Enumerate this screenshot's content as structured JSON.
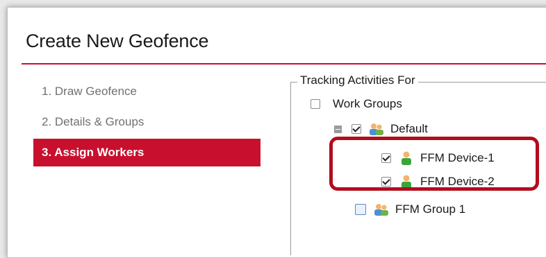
{
  "page": {
    "title": "Create New Geofence"
  },
  "steps": [
    {
      "label": "1.  Draw Geofence",
      "active": false
    },
    {
      "label": "2.  Details & Groups",
      "active": false
    },
    {
      "label": "3.  Assign Workers",
      "active": true
    }
  ],
  "tracking": {
    "legend": "Tracking Activities For",
    "work_groups_label": "Work Groups",
    "default_group_label": "Default",
    "device1_label": "FFM Device-1",
    "device2_label": "FFM Device-2",
    "group1_label": "FFM Group 1"
  },
  "colors": {
    "accent": "#c8102e",
    "highlight_border": "#b20d1e",
    "person_green": "#3aa53a",
    "person_skin": "#f2b46b",
    "group_blue": "#4a90d9"
  },
  "icons": {
    "device": "person-icon",
    "group": "group-icon",
    "collapse": "collapse-icon"
  }
}
